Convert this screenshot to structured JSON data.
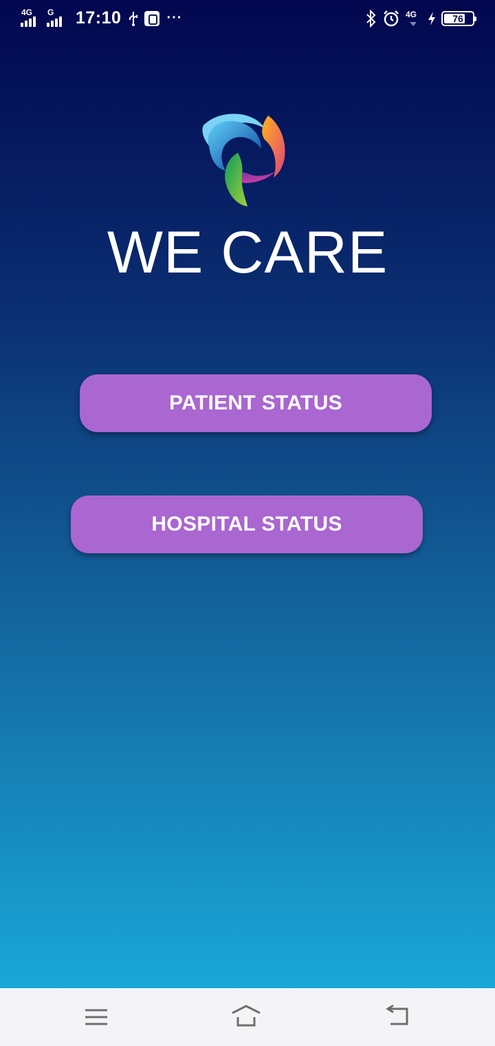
{
  "status_bar": {
    "sim1_network": "4G",
    "sim2_network": "G",
    "time": "17:10",
    "more": "···",
    "data_network": "4G",
    "battery": "76",
    "battery_level": 0.76
  },
  "app": {
    "title": "WE CARE"
  },
  "buttons": {
    "patient_status": "PATIENT STATUS",
    "hospital_status": "HOSPITAL STATUS"
  },
  "colors": {
    "button": "#aa66d1",
    "gradient_top": "#02074f",
    "gradient_bottom": "#1ab2e0",
    "nav_bar": "#f4f4f6"
  },
  "icons": {
    "status_left": [
      "signal-icon",
      "signal-icon",
      "usb-icon",
      "debug-icon",
      "more-icon"
    ],
    "status_right": [
      "bluetooth-icon",
      "alarm-icon",
      "mobile-data-icon",
      "charging-icon",
      "battery-icon"
    ],
    "nav": [
      "menu-icon",
      "home-icon",
      "back-icon"
    ]
  }
}
